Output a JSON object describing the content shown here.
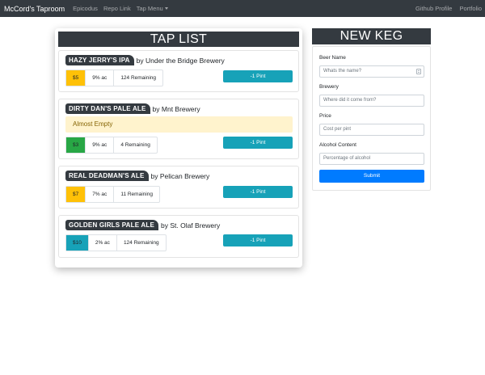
{
  "navbar": {
    "brand": "McCord's Taproom",
    "links": [
      "Epicodus",
      "Repo Link",
      "Tap Menu"
    ],
    "right_links": [
      "Github Profile",
      "Portfolio"
    ]
  },
  "tap_list": {
    "header": "TAP LIST",
    "kegs": [
      {
        "name": "HAZY JERRY'S IPA",
        "brewery": "by Under the Bridge Brewery",
        "price": "$5",
        "price_color": "#ffc107",
        "abv": "9% ac",
        "remaining": "124 Remaining",
        "button": "-1 Pint",
        "alert": ""
      },
      {
        "name": "DIRTY DAN'S PALE ALE",
        "brewery": "by Mnt Brewery",
        "price": "$3",
        "price_color": "#28a745",
        "abv": "9% ac",
        "remaining": "4 Remaining",
        "button": "-1 Pint",
        "alert": "Almost Empty"
      },
      {
        "name": "REAL DEADMAN'S ALE",
        "brewery": "by Pelican Brewery",
        "price": "$7",
        "price_color": "#ffc107",
        "abv": "7% ac",
        "remaining": "11 Remaining",
        "button": "-1 Pint",
        "alert": ""
      },
      {
        "name": "GOLDEN GIRLS PALE ALE",
        "brewery": "by St. Olaf Brewery",
        "price": "$10",
        "price_color": "#17a2b8",
        "abv": "2% ac",
        "remaining": "124 Remaining",
        "button": "-1 Pint",
        "alert": ""
      }
    ]
  },
  "new_keg": {
    "header": "NEW KEG",
    "fields": [
      {
        "label": "Beer Name",
        "placeholder": "Whats the name?"
      },
      {
        "label": "Brewery",
        "placeholder": "Where did it come from?"
      },
      {
        "label": "Price",
        "placeholder": "Cost per pint"
      },
      {
        "label": "Alcohol Content",
        "placeholder": "Percentage of alcohol"
      }
    ],
    "submit": "Submit"
  }
}
